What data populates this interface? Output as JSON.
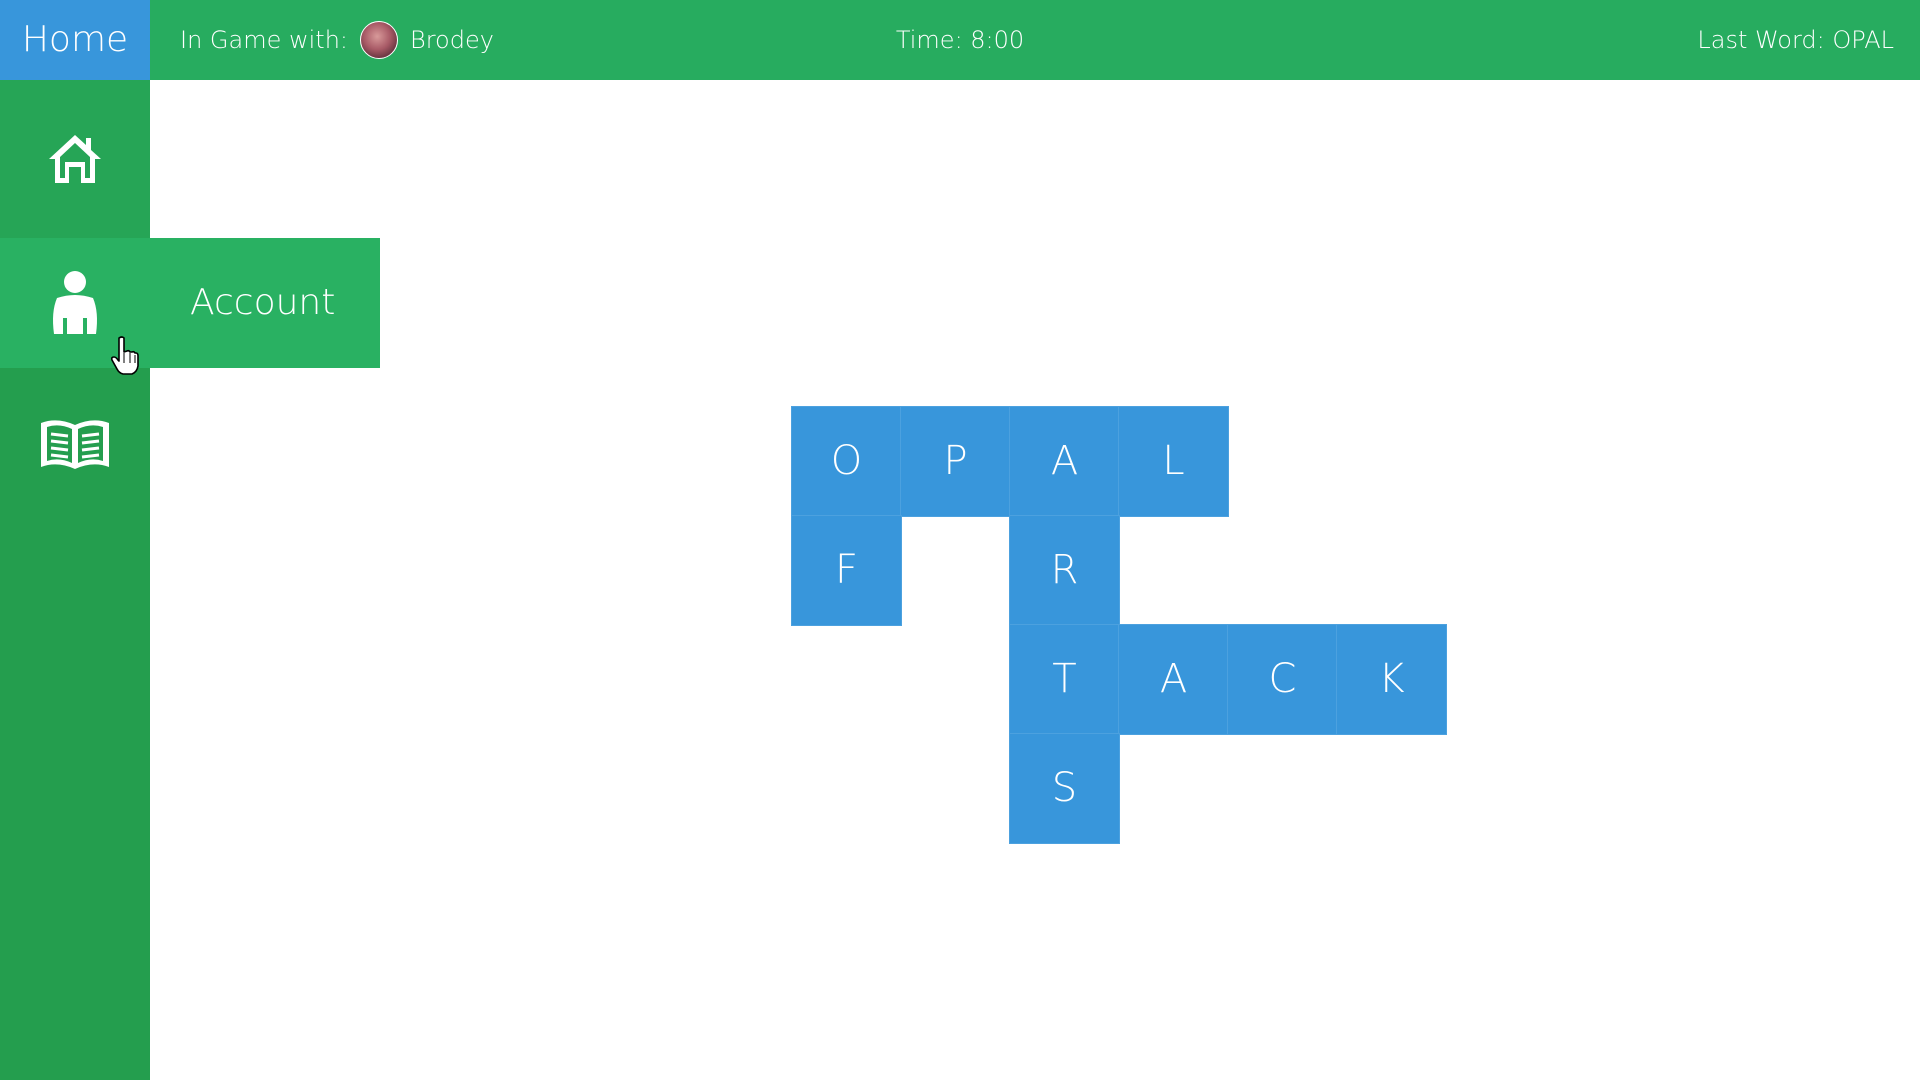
{
  "topbar": {
    "home_label": "Home",
    "in_game_label": "In Game with:",
    "opponent_name": "Brodey",
    "timer_text": "Time: 8:00",
    "last_word_text": "Last Word: OPAL"
  },
  "sidebar": {
    "account_label": "Account",
    "items": [
      {
        "icon": "home-icon"
      },
      {
        "icon": "person-icon"
      },
      {
        "icon": "book-icon"
      }
    ]
  },
  "board": {
    "tiles": [
      {
        "letter": "O",
        "row": 0,
        "col": 0
      },
      {
        "letter": "P",
        "row": 0,
        "col": 1
      },
      {
        "letter": "A",
        "row": 0,
        "col": 2
      },
      {
        "letter": "L",
        "row": 0,
        "col": 3
      },
      {
        "letter": "F",
        "row": 1,
        "col": 0
      },
      {
        "letter": "R",
        "row": 1,
        "col": 2
      },
      {
        "letter": "T",
        "row": 2,
        "col": 2
      },
      {
        "letter": "A",
        "row": 2,
        "col": 3
      },
      {
        "letter": "C",
        "row": 2,
        "col": 4
      },
      {
        "letter": "K",
        "row": 2,
        "col": 5
      },
      {
        "letter": "S",
        "row": 3,
        "col": 2
      }
    ]
  },
  "colors": {
    "green": "#27ac5f",
    "blue": "#3896db"
  }
}
